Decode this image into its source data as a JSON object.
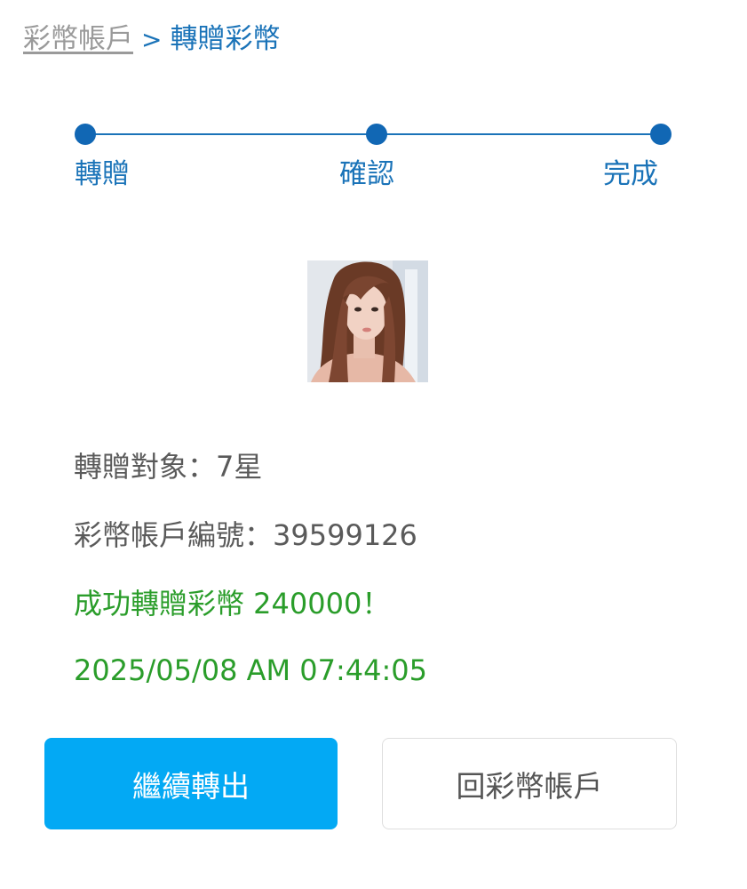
{
  "breadcrumb": {
    "parent": "彩幣帳戶",
    "separator": ">",
    "current": "轉贈彩幣"
  },
  "steps": [
    {
      "label": "轉贈"
    },
    {
      "label": "確認"
    },
    {
      "label": "完成"
    }
  ],
  "recipient": {
    "label": "轉贈對象：",
    "name": "7星",
    "account_label": "彩幣帳戶編號：",
    "account_number": "39599126"
  },
  "result": {
    "message": "成功轉贈彩幣 240000！",
    "timestamp": "2025/05/08 AM 07:44:05"
  },
  "actions": {
    "continue_label": "繼續轉出",
    "back_label": "回彩幣帳戶"
  },
  "colors": {
    "primary_blue": "#1a73b8",
    "button_blue": "#03a9f4",
    "success_green": "#2a9d2a"
  }
}
